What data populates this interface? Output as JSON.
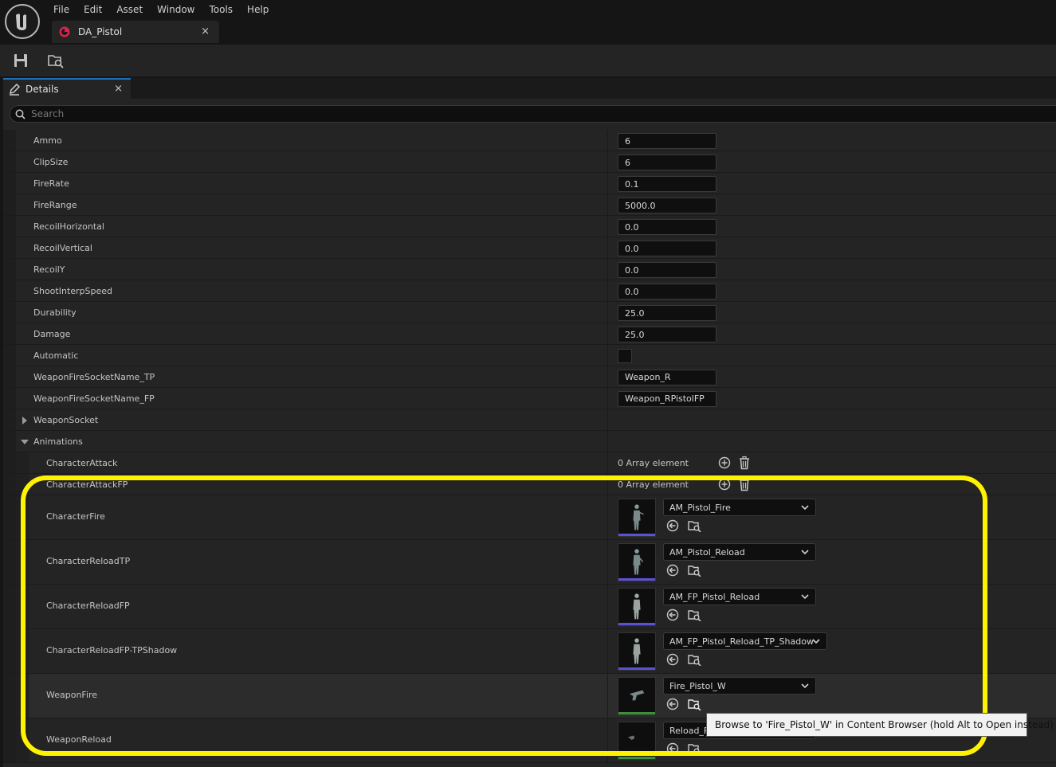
{
  "menu": [
    "File",
    "Edit",
    "Asset",
    "Window",
    "Tools",
    "Help"
  ],
  "document_tab": {
    "title": "DA_Pistol",
    "close": "×"
  },
  "details_tab": {
    "title": "Details",
    "close": "×"
  },
  "search": {
    "placeholder": "Search"
  },
  "properties": {
    "ammo": {
      "label": "Ammo",
      "value": "6"
    },
    "clip_size": {
      "label": "ClipSize",
      "value": "6"
    },
    "fire_rate": {
      "label": "FireRate",
      "value": "0.1"
    },
    "fire_range": {
      "label": "FireRange",
      "value": "5000.0"
    },
    "recoil_horizontal": {
      "label": "RecoilHorizontal",
      "value": "0.0"
    },
    "recoil_vertical": {
      "label": "RecoilVertical",
      "value": "0.0"
    },
    "recoil_y": {
      "label": "RecoilY",
      "value": "0.0"
    },
    "shoot_interp_speed": {
      "label": "ShootInterpSpeed",
      "value": "0.0"
    },
    "durability": {
      "label": "Durability",
      "value": "25.0"
    },
    "damage": {
      "label": "Damage",
      "value": "25.0"
    },
    "automatic": {
      "label": "Automatic",
      "checked": false
    },
    "socket_tp": {
      "label": "WeaponFireSocketName_TP",
      "value": "Weapon_R"
    },
    "socket_fp": {
      "label": "WeaponFireSocketName_FP",
      "value": "Weapon_RPistolFP"
    },
    "weapon_socket": {
      "label": "WeaponSocket"
    },
    "animations": {
      "label": "Animations"
    },
    "character_attack": {
      "label": "CharacterAttack",
      "value": "0 Array element"
    },
    "character_attack_fp": {
      "label": "CharacterAttackFP",
      "value": "0 Array element"
    }
  },
  "assets": {
    "character_fire": {
      "label": "CharacterFire",
      "value": "AM_Pistol_Fire",
      "accent": "#5a52d6"
    },
    "character_reload_tp": {
      "label": "CharacterReloadTP",
      "value": "AM_Pistol_Reload",
      "accent": "#5a52d6"
    },
    "character_reload_fp": {
      "label": "CharacterReloadFP",
      "value": "AM_FP_Pistol_Reload",
      "accent": "#5a52d6"
    },
    "character_reload_fp_shadow": {
      "label": "CharacterReloadFP-TPShadow",
      "value": "AM_FP_Pistol_Reload_TP_Shadow",
      "accent": "#5a52d6"
    },
    "weapon_fire": {
      "label": "WeaponFire",
      "value": "Fire_Pistol_W",
      "accent": "#3f8f3a"
    },
    "weapon_reload": {
      "label": "WeaponReload",
      "value": "Reload_P",
      "accent": "#3f8f3a"
    }
  },
  "tooltip": "Browse to 'Fire_Pistol_W' in Content Browser (hold Alt to Open instead)",
  "colors": {
    "highlight": "#fff200",
    "asset_accent": "#e0204f",
    "panel_tab_accent": "#1f6fb8"
  }
}
